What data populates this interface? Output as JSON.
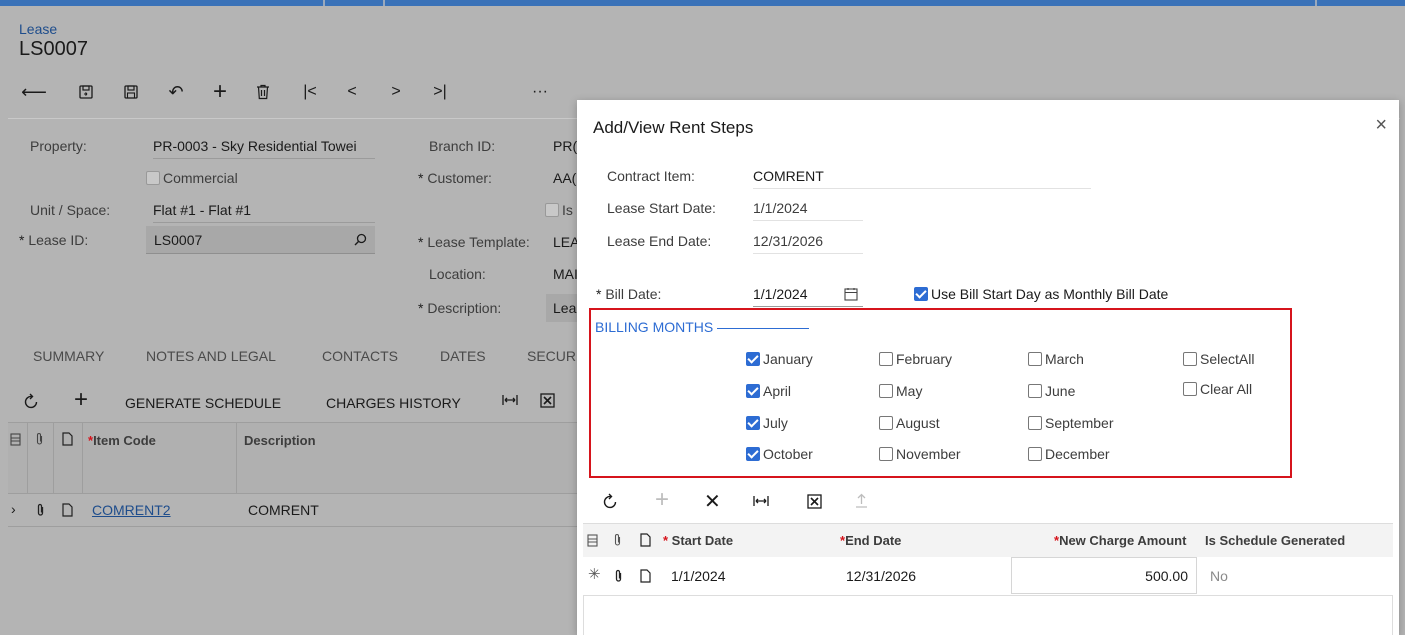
{
  "header": {
    "breadcrumb": "Lease",
    "title": "LS0007"
  },
  "toolbar": {
    "back": "⟵",
    "save_close": "⎙",
    "save": "🖫",
    "undo": "↶",
    "add": "+",
    "delete": "🗑",
    "first": "|<",
    "prev": "<",
    "next": ">",
    "last": ">|",
    "more": "···"
  },
  "form": {
    "property_label": "Property:",
    "property_value": "PR-0003 - Sky Residential Towei",
    "commercial_label": "Commercial",
    "unit_label": "Unit / Space:",
    "unit_value": "Flat #1 - Flat #1",
    "lease_id_label": "Lease ID:",
    "lease_id_value": "LS0007",
    "branch_label": "Branch ID:",
    "branch_value": "PR(",
    "customer_label": "Customer:",
    "customer_value": "AA(",
    "is_label": "Is",
    "template_label": "Lease Template:",
    "template_value": "LEA",
    "location_label": "Location:",
    "location_value": "MAI",
    "description_label": "Description:",
    "description_value": "Lea"
  },
  "tabs": [
    "SUMMARY",
    "NOTES AND LEGAL",
    "CONTACTS",
    "DATES",
    "SECUR"
  ],
  "grid_toolbar": {
    "generate": "GENERATE SCHEDULE",
    "charges": "CHARGES HISTORY"
  },
  "grid": {
    "col_item_code": "Item Code",
    "col_description": "Description",
    "row_item_code": "COMRENT2",
    "row_description": "COMRENT"
  },
  "dialog": {
    "title": "Add/View Rent Steps",
    "close": "×",
    "contract_item_label": "Contract Item:",
    "contract_item_value": "COMRENT",
    "start_label": "Lease Start Date:",
    "start_value": "1/1/2024",
    "end_label": "Lease End Date:",
    "end_value": "12/31/2026",
    "bill_date_label": "Bill Date:",
    "bill_date_value": "1/1/2024",
    "use_bill_start": "Use Bill Start Day as Monthly Bill Date",
    "billing_months_title": "BILLING MONTHS",
    "months": {
      "jan": "January",
      "feb": "February",
      "mar": "March",
      "apr": "April",
      "may": "May",
      "jun": "June",
      "jul": "July",
      "aug": "August",
      "sep": "September",
      "oct": "October",
      "nov": "November",
      "dec": "December"
    },
    "select_all": "SelectAll",
    "clear_all": "Clear All",
    "subgrid": {
      "col_start": "Start Date",
      "col_end": "End Date",
      "col_amount": "New Charge Amount",
      "col_generated": "Is Schedule Generated",
      "row_start": "1/1/2024",
      "row_end": "12/31/2026",
      "row_amount": "500.00",
      "row_generated": "No"
    }
  },
  "colors": {
    "accent": "#2d6cd3",
    "highlight_border": "#d6141c",
    "link": "#1e4d8c"
  }
}
